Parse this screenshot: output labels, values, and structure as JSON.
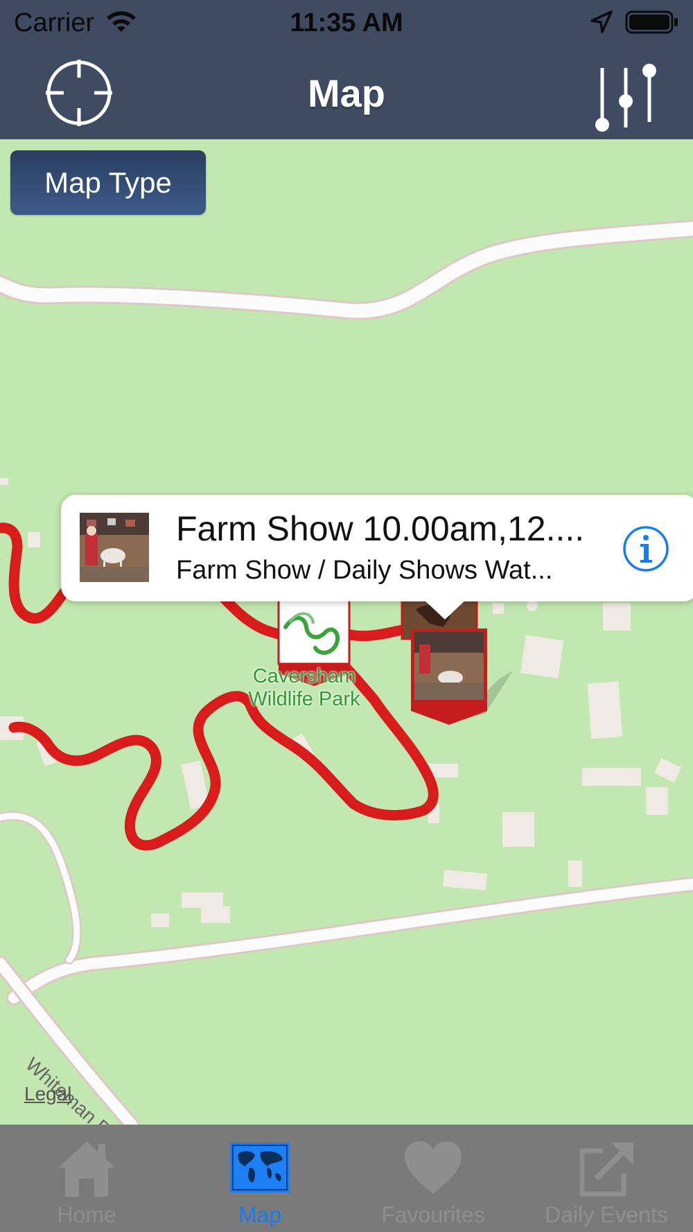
{
  "status_bar": {
    "carrier": "Carrier",
    "time": "11:35 AM",
    "icons": [
      "wifi-icon",
      "location-arrow-icon",
      "battery-icon"
    ]
  },
  "nav_bar": {
    "title": "Map",
    "left_icon": "locate-crosshair-icon",
    "right_icon": "filter-sliders-icon"
  },
  "map": {
    "map_type_label": "Map Type",
    "park_label": "Caversham Wildlife Park",
    "road_label": "Whiteman Dr E",
    "legal_label": "Legal",
    "route_color": "#d81b1b",
    "pins": [
      "park-logo-pin",
      "farm-show-pin",
      "horse-pin"
    ]
  },
  "callout": {
    "title": "Farm Show 10.00am,12....",
    "subtitle": "Farm Show / Daily Shows Wat...",
    "info_icon": "info-icon"
  },
  "tab_bar": {
    "items": [
      {
        "label": "Home",
        "icon": "home-icon",
        "active": false
      },
      {
        "label": "Map",
        "icon": "world-map-icon",
        "active": true
      },
      {
        "label": "Favourites",
        "icon": "heart-icon",
        "active": false
      },
      {
        "label": "Daily Events",
        "icon": "external-link-icon",
        "active": false
      }
    ],
    "active_color": "#1a7cf0",
    "inactive_color": "#8e8e8e"
  }
}
